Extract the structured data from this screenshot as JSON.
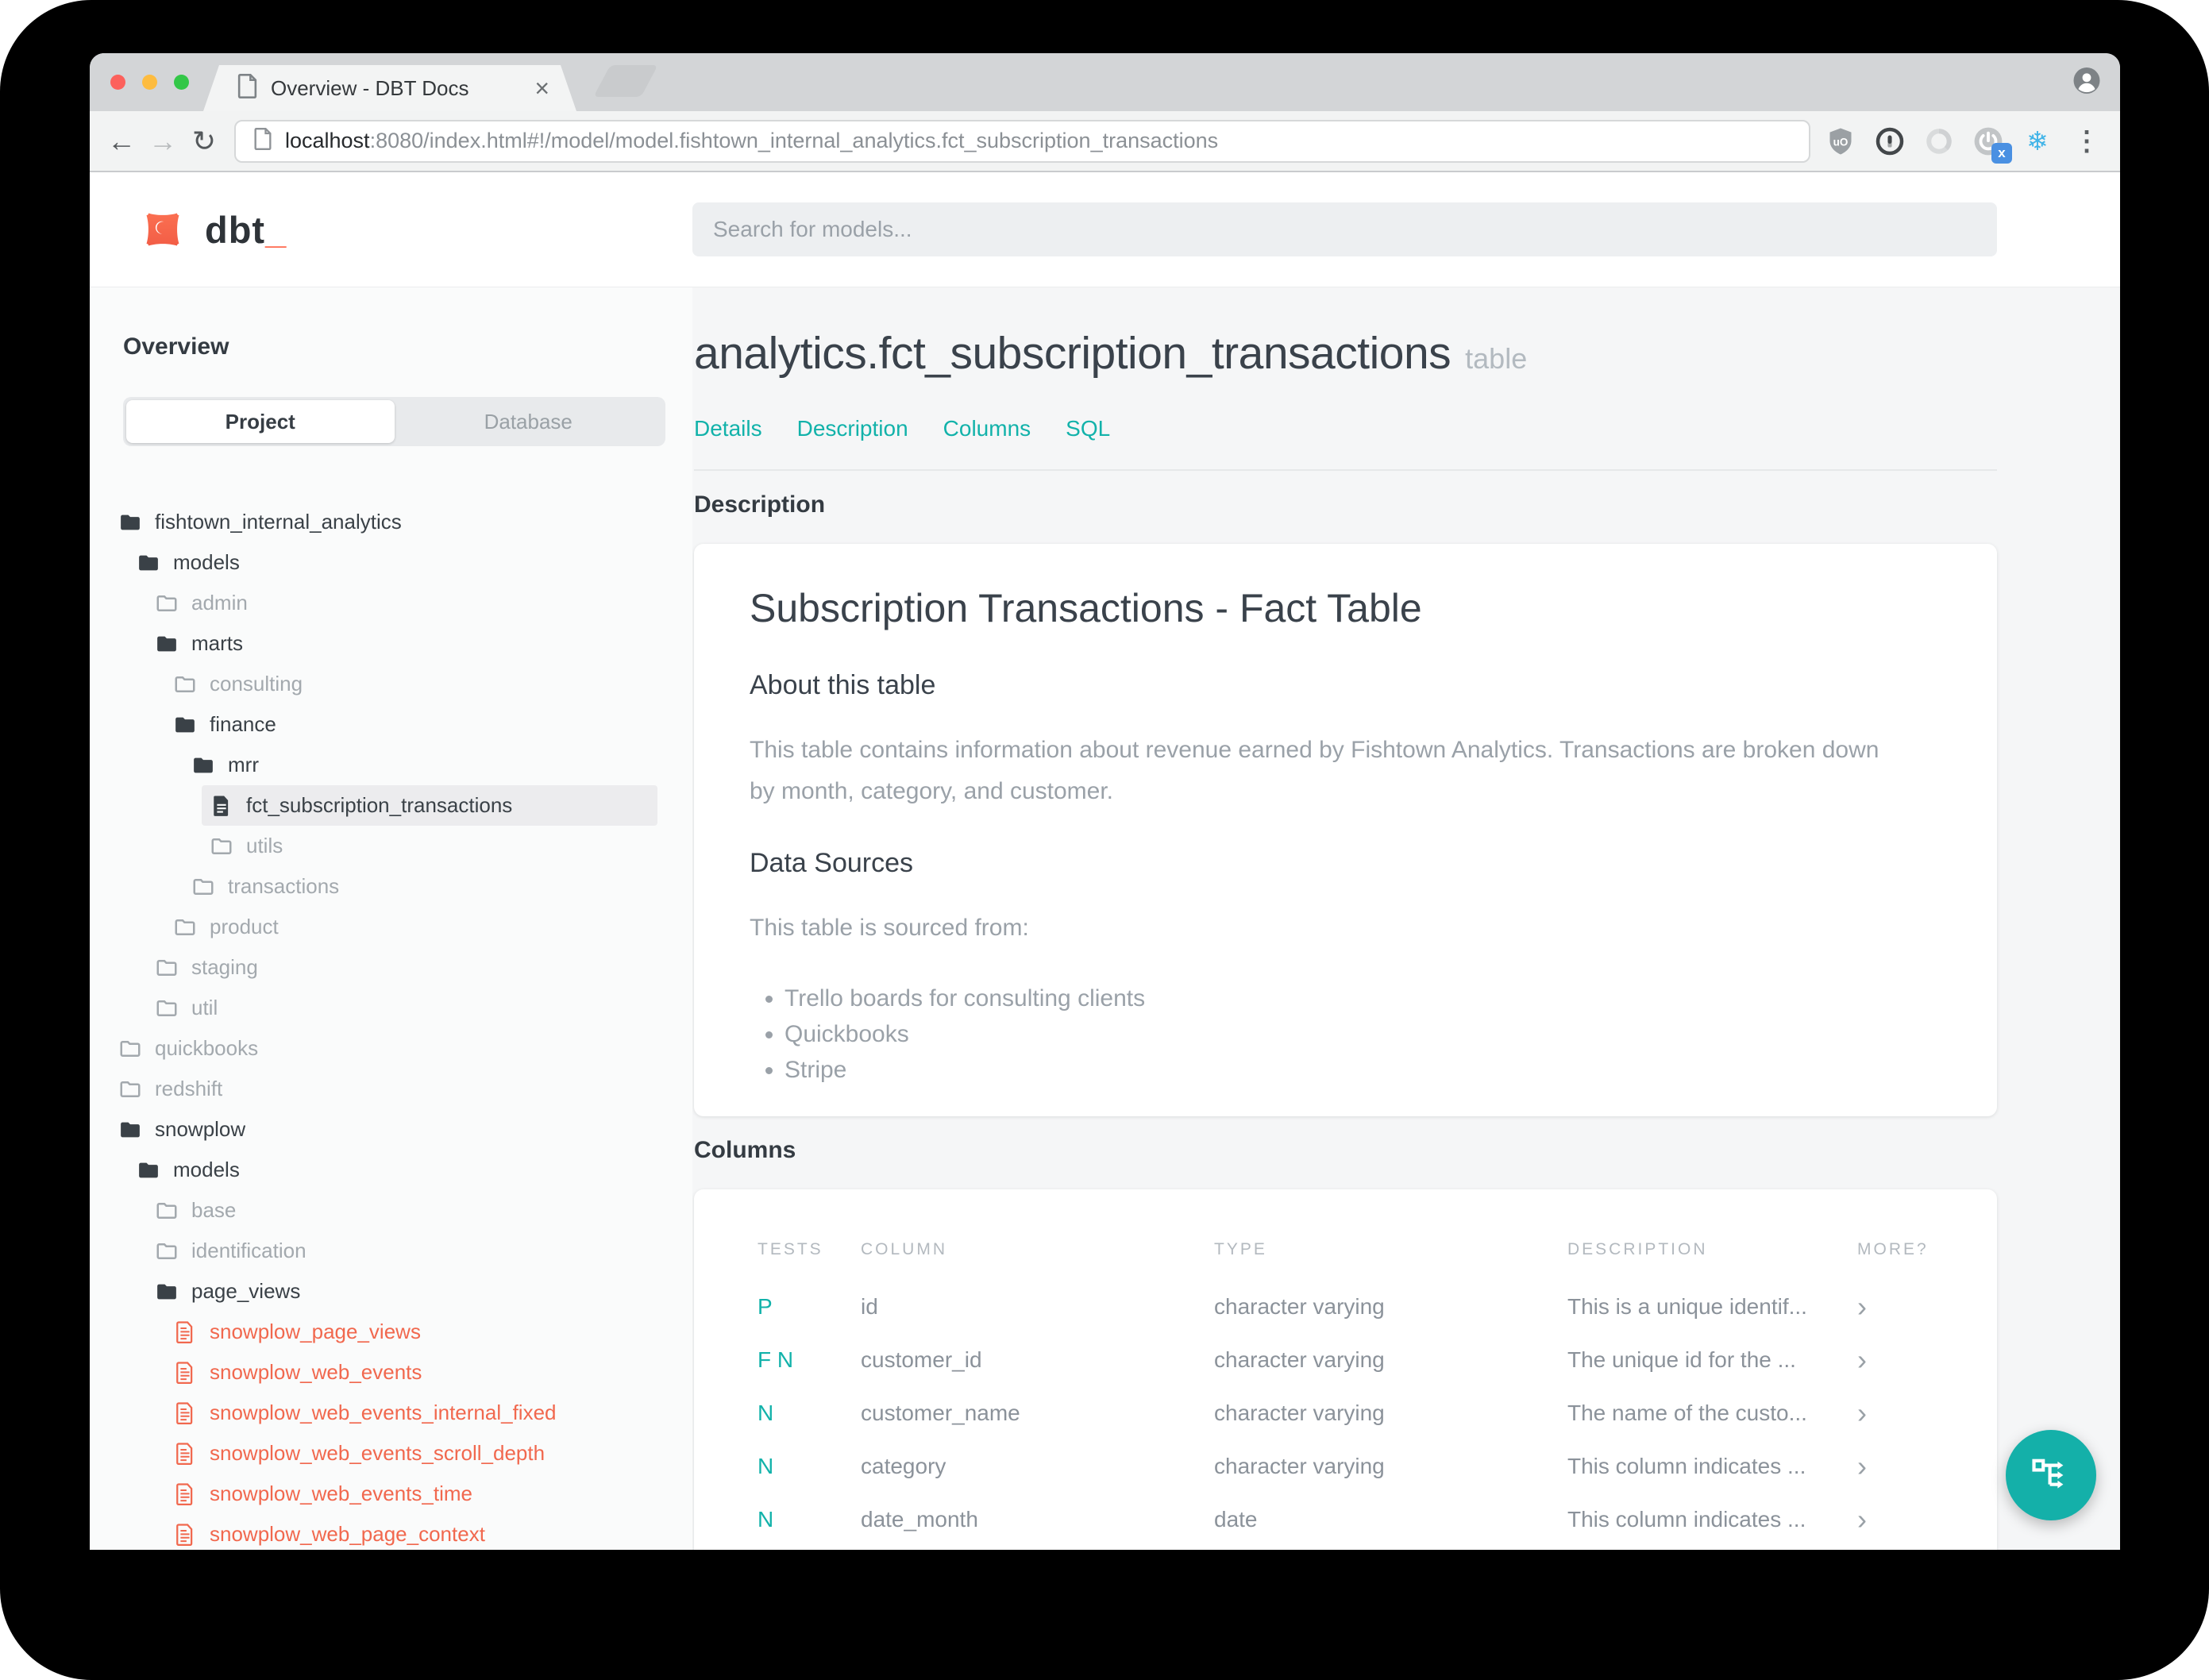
{
  "browser": {
    "tab_title": "Overview - DBT Docs",
    "tab_close": "×",
    "back": "←",
    "forward": "→",
    "reload": "↻",
    "url_host": "localhost",
    "url_rest": ":8080/index.html#!/model/model.fishtown_internal_analytics.fct_subscription_transactions",
    "extension_badge": "x",
    "menu_dots": "⋮",
    "snowflake": "❄"
  },
  "header": {
    "brand": "dbt",
    "brand_cursor": "_",
    "search_placeholder": "Search for models..."
  },
  "sidebar": {
    "heading": "Overview",
    "tabs": {
      "project": "Project",
      "database": "Database"
    },
    "tree": [
      {
        "label": "fishtown_internal_analytics",
        "level": 0,
        "icon": "folder-open",
        "state": "strong"
      },
      {
        "label": "models",
        "level": 1,
        "icon": "folder-open",
        "state": "strong"
      },
      {
        "label": "admin",
        "level": 2,
        "icon": "folder",
        "state": "muted"
      },
      {
        "label": "marts",
        "level": 2,
        "icon": "folder-open",
        "state": "strong"
      },
      {
        "label": "consulting",
        "level": 3,
        "icon": "folder",
        "state": "muted"
      },
      {
        "label": "finance",
        "level": 3,
        "icon": "folder-open",
        "state": "strong"
      },
      {
        "label": "mrr",
        "level": 4,
        "icon": "folder-open",
        "state": "strong"
      },
      {
        "label": "fct_subscription_transactions",
        "level": 5,
        "icon": "file",
        "state": "selected"
      },
      {
        "label": "utils",
        "level": 5,
        "icon": "folder",
        "state": "muted"
      },
      {
        "label": "transactions",
        "level": 4,
        "icon": "folder",
        "state": "muted"
      },
      {
        "label": "product",
        "level": 3,
        "icon": "folder",
        "state": "muted"
      },
      {
        "label": "staging",
        "level": 2,
        "icon": "folder",
        "state": "muted"
      },
      {
        "label": "util",
        "level": 2,
        "icon": "folder",
        "state": "muted"
      },
      {
        "label": "quickbooks",
        "level": 0,
        "icon": "folder",
        "state": "muted"
      },
      {
        "label": "redshift",
        "level": 0,
        "icon": "folder",
        "state": "muted"
      },
      {
        "label": "snowplow",
        "level": 0,
        "icon": "folder-open",
        "state": "strong"
      },
      {
        "label": "models",
        "level": 1,
        "icon": "folder-open",
        "state": "strong"
      },
      {
        "label": "base",
        "level": 2,
        "icon": "folder",
        "state": "muted"
      },
      {
        "label": "identification",
        "level": 2,
        "icon": "folder",
        "state": "muted"
      },
      {
        "label": "page_views",
        "level": 2,
        "icon": "folder-open",
        "state": "strong"
      },
      {
        "label": "snowplow_page_views",
        "level": 3,
        "icon": "file-outline",
        "state": "error"
      },
      {
        "label": "snowplow_web_events",
        "level": 3,
        "icon": "file-outline",
        "state": "error"
      },
      {
        "label": "snowplow_web_events_internal_fixed",
        "level": 3,
        "icon": "file-outline",
        "state": "error"
      },
      {
        "label": "snowplow_web_events_scroll_depth",
        "level": 3,
        "icon": "file-outline",
        "state": "error"
      },
      {
        "label": "snowplow_web_events_time",
        "level": 3,
        "icon": "file-outline",
        "state": "error"
      },
      {
        "label": "snowplow_web_page_context",
        "level": 3,
        "icon": "file-outline",
        "state": "error"
      }
    ]
  },
  "main": {
    "title": "analytics.fct_subscription_transactions",
    "title_badge": "table",
    "nav": [
      "Details",
      "Description",
      "Columns",
      "SQL"
    ],
    "description_label": "Description",
    "columns_label": "Columns"
  },
  "description_card": {
    "heading": "Subscription Transactions - Fact Table",
    "about_heading": "About this table",
    "about_text": "This table contains information about revenue earned by Fishtown Analytics. Transactions are broken down by month, category, and customer.",
    "sources_heading": "Data Sources",
    "sources_intro": "This table is sourced from:",
    "sources": [
      "Trello boards for consulting clients",
      "Quickbooks",
      "Stripe"
    ]
  },
  "columns_table": {
    "headers": [
      "TESTS",
      "COLUMN",
      "TYPE",
      "DESCRIPTION",
      "MORE?"
    ],
    "rows": [
      {
        "tests": "P",
        "column": "id",
        "type": "character varying",
        "description": "This is a unique identif...",
        "more": "›"
      },
      {
        "tests": "F N",
        "column": "customer_id",
        "type": "character varying",
        "description": "The unique id for the ...",
        "more": "›"
      },
      {
        "tests": "N",
        "column": "customer_name",
        "type": "character varying",
        "description": "The name of the custo...",
        "more": "›"
      },
      {
        "tests": "N",
        "column": "category",
        "type": "character varying",
        "description": "This column indicates ...",
        "more": "›"
      },
      {
        "tests": "N",
        "column": "date_month",
        "type": "date",
        "description": "This column indicates ...",
        "more": "›"
      }
    ]
  },
  "colors": {
    "accent_teal": "#14b0a9",
    "error_red": "#f1684e",
    "brand_orange": "#ff6a4f",
    "traffic_red": "#fc615c",
    "traffic_yellow": "#fdbc40",
    "traffic_green": "#33c748"
  }
}
